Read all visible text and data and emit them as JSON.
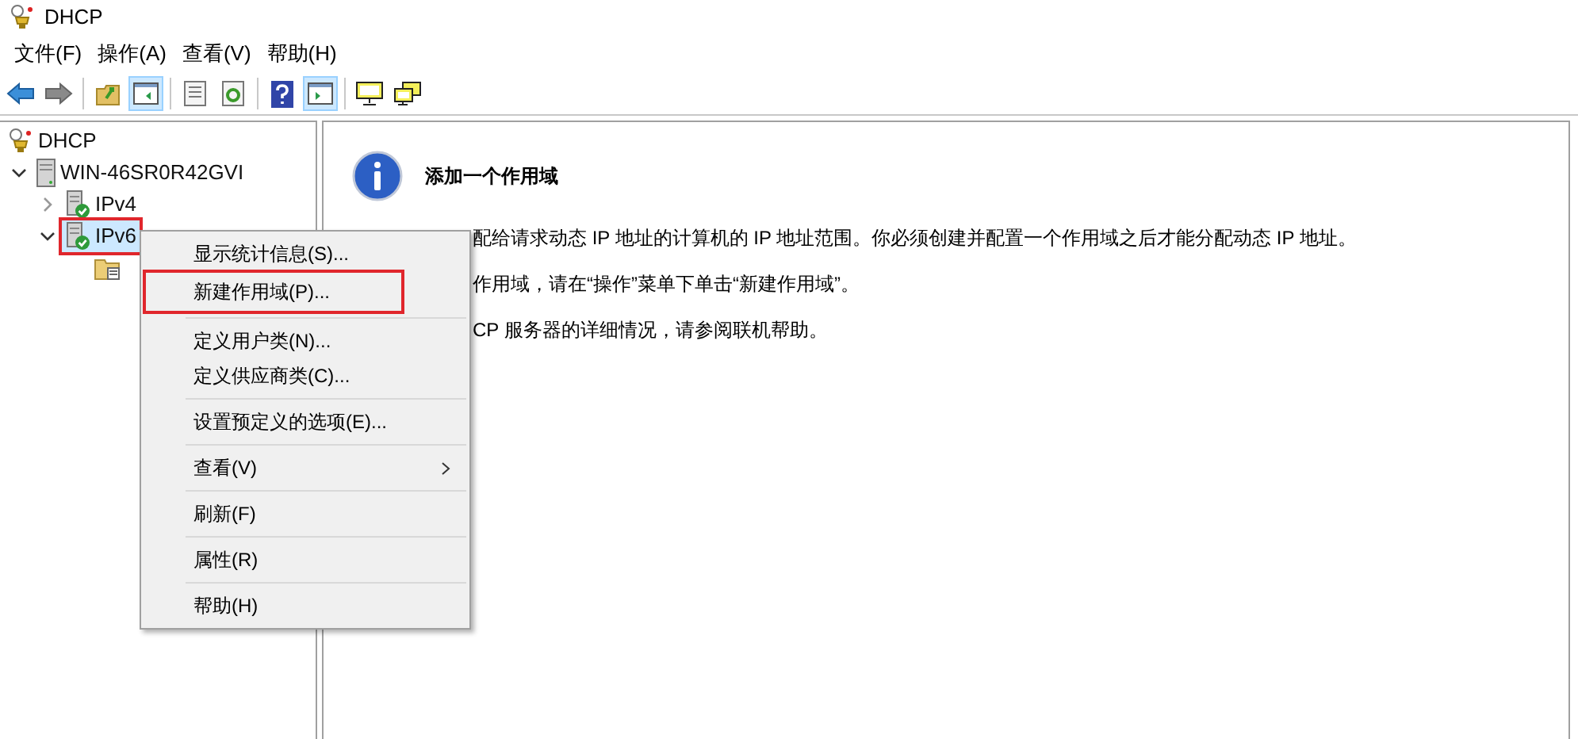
{
  "window": {
    "title": "DHCP"
  },
  "menu_bar": [
    "文件(F)",
    "操作(A)",
    "查看(V)",
    "帮助(H)"
  ],
  "toolbar": [
    [
      {
        "kind": "back",
        "pressed": false
      },
      {
        "kind": "forward",
        "pressed": false
      }
    ],
    [
      {
        "kind": "up",
        "pressed": false
      },
      {
        "kind": "tree",
        "pressed": true
      }
    ],
    [
      {
        "kind": "list",
        "pressed": false
      },
      {
        "kind": "refresh",
        "pressed": false
      }
    ],
    [
      {
        "kind": "help",
        "pressed": false
      },
      {
        "kind": "actionpane",
        "pressed": true
      }
    ],
    [
      {
        "kind": "monitor",
        "pressed": false
      },
      {
        "kind": "monitors",
        "pressed": false
      }
    ]
  ],
  "tree": [
    {
      "label": "DHCP",
      "kind": "root",
      "selected": false,
      "annotated": false,
      "children": [
        {
          "label": "WIN-46SR0R42GVI",
          "kind": "server",
          "expanded": true,
          "selected": false,
          "annotated": false,
          "children": [
            {
              "label": "IPv4",
              "kind": "protocol",
              "expanded": false,
              "selected": false,
              "annotated": false
            },
            {
              "label": "IPv6",
              "kind": "protocol",
              "expanded": true,
              "selected": true,
              "annotated": true,
              "children": [
                {
                  "kind": "folder",
                  "selected": false,
                  "annotated": false
                }
              ]
            }
          ]
        }
      ]
    }
  ],
  "content": {
    "title": "添加一个作用域",
    "paragraphs": [
      "配给请求动态 IP 地址的计算机的 IP 地址范围。你必须创建并配置一个作用域之后才能分配动态 IP 地址。",
      "作用域，请在“操作”菜单下单击“新建作用域”。",
      "CP 服务器的详细情况，请参阅联机帮助。"
    ]
  },
  "context_menu": [
    {
      "kind": "item",
      "label": "显示统计信息(S)...",
      "submenu": false,
      "annotated": false
    },
    {
      "kind": "item",
      "label": "新建作用域(P)...",
      "submenu": false,
      "annotated": true
    },
    {
      "kind": "separator"
    },
    {
      "kind": "item",
      "label": "定义用户类(N)...",
      "submenu": false,
      "annotated": false
    },
    {
      "kind": "item",
      "label": "定义供应商类(C)...",
      "submenu": false,
      "annotated": false
    },
    {
      "kind": "separator"
    },
    {
      "kind": "item",
      "label": "设置预定义的选项(E)...",
      "submenu": false,
      "annotated": false
    },
    {
      "kind": "separator"
    },
    {
      "kind": "item",
      "label": "查看(V)",
      "submenu": true,
      "annotated": false
    },
    {
      "kind": "separator"
    },
    {
      "kind": "item",
      "label": "刷新(F)",
      "submenu": false,
      "annotated": false
    },
    {
      "kind": "separator"
    },
    {
      "kind": "item",
      "label": "属性(R)",
      "submenu": false,
      "annotated": false
    },
    {
      "kind": "separator"
    },
    {
      "kind": "item",
      "label": "帮助(H)",
      "submenu": false,
      "annotated": false
    }
  ]
}
